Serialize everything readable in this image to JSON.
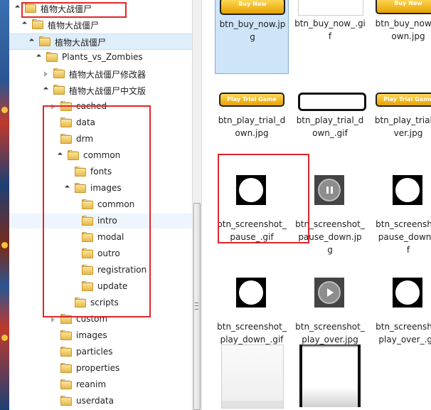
{
  "tree": [
    {
      "label": "植物大战僵尸",
      "depth": 0,
      "expanded": true,
      "state": ""
    },
    {
      "label": "植物大战僵尸",
      "depth": 1,
      "expanded": true,
      "state": ""
    },
    {
      "label": "植物大战僵尸",
      "depth": 2,
      "expanded": true,
      "state": "selected"
    },
    {
      "label": "Plants_vs_Zombies",
      "depth": 3,
      "expanded": true,
      "state": ""
    },
    {
      "label": "植物大战僵尸修改器",
      "depth": 4,
      "expanded": false,
      "state": ""
    },
    {
      "label": "植物大战僵尸中文版",
      "depth": 4,
      "expanded": true,
      "state": ""
    },
    {
      "label": "cached",
      "depth": 5,
      "expanded": false,
      "state": ""
    },
    {
      "label": "data",
      "depth": 5,
      "expanded": null,
      "state": ""
    },
    {
      "label": "drm",
      "depth": 5,
      "expanded": null,
      "state": ""
    },
    {
      "label": "common",
      "depth": 6,
      "expanded": true,
      "state": ""
    },
    {
      "label": "fonts",
      "depth": 7,
      "expanded": null,
      "state": ""
    },
    {
      "label": "images",
      "depth": 7,
      "expanded": true,
      "state": ""
    },
    {
      "label": "common",
      "depth": 8,
      "expanded": null,
      "state": ""
    },
    {
      "label": "intro",
      "depth": 8,
      "expanded": null,
      "state": "hover"
    },
    {
      "label": "modal",
      "depth": 8,
      "expanded": null,
      "state": ""
    },
    {
      "label": "outro",
      "depth": 8,
      "expanded": null,
      "state": ""
    },
    {
      "label": "registration",
      "depth": 8,
      "expanded": null,
      "state": ""
    },
    {
      "label": "update",
      "depth": 8,
      "expanded": null,
      "state": ""
    },
    {
      "label": "scripts",
      "depth": 7,
      "expanded": null,
      "state": ""
    },
    {
      "label": "custom",
      "depth": 5,
      "expanded": false,
      "state": ""
    },
    {
      "label": "images",
      "depth": 5,
      "expanded": null,
      "state": ""
    },
    {
      "label": "particles",
      "depth": 5,
      "expanded": null,
      "state": ""
    },
    {
      "label": "properties",
      "depth": 5,
      "expanded": null,
      "state": ""
    },
    {
      "label": "reanim",
      "depth": 5,
      "expanded": null,
      "state": ""
    },
    {
      "label": "userdata",
      "depth": 5,
      "expanded": null,
      "state": ""
    }
  ],
  "files": [
    {
      "name": "btn_buy_now.jpg",
      "lines": [
        "btn_buy_now.jp",
        "g"
      ],
      "thumb": "buy",
      "selected": true
    },
    {
      "name": "btn_buy_now_.gif",
      "lines": [
        "btn_buy_now_.gi",
        "f"
      ],
      "thumb": "blank-white",
      "selected": false
    },
    {
      "name": "btn_buy_now_down.jpg",
      "lines": [
        "btn_buy_now_d",
        "own.jpg"
      ],
      "thumb": "buy",
      "selected": false
    },
    {
      "name": "btn_play_trial_down.jpg",
      "lines": [
        "btn_play_trial_d",
        "own.jpg"
      ],
      "thumb": "trial",
      "selected": false
    },
    {
      "name": "btn_play_trial_down_.gif",
      "lines": [
        "btn_play_trial_d",
        "own_.gif"
      ],
      "thumb": "blank-white-bar",
      "selected": false
    },
    {
      "name": "btn_play_trial_over.jpg",
      "lines": [
        "btn_play_trial_o",
        "ver.jpg"
      ],
      "thumb": "trial",
      "selected": false
    },
    {
      "name": "btn_screenshot_pause_.gif",
      "lines": [
        "btn_screenshot_",
        "pause_.gif"
      ],
      "thumb": "black-circle",
      "selected": false
    },
    {
      "name": "btn_screenshot_pause_down.jpg",
      "lines": [
        "btn_screenshot_",
        "pause_down.jp",
        "g"
      ],
      "thumb": "pause",
      "selected": false
    },
    {
      "name": "btn_screenshot_pause_down_.gif",
      "lines": [
        "btn_screenshot",
        "pause_down_.",
        "f"
      ],
      "thumb": "black-circle",
      "selected": false
    },
    {
      "name": "btn_screenshot_play_down_.gif",
      "lines": [
        "btn_screenshot_",
        "play_down_.gif"
      ],
      "thumb": "black-circle",
      "selected": false
    },
    {
      "name": "btn_screenshot_play_over.jpg",
      "lines": [
        "btn_screenshot_",
        "play_over.jpg"
      ],
      "thumb": "play",
      "selected": false
    },
    {
      "name": "btn_screenshot_play_over_.gif",
      "lines": [
        "btn_screenshot",
        "play_over_.gif"
      ],
      "thumb": "black-circle",
      "selected": false
    },
    {
      "name": "",
      "lines": [],
      "thumb": "panel-white",
      "selected": false
    },
    {
      "name": "",
      "lines": [],
      "thumb": "panel-gradient",
      "selected": false
    }
  ],
  "thumb_text": {
    "buy": "Buy Now",
    "trial": "Play Trial Game"
  },
  "colors": {
    "annotation": "#e0262a",
    "selection": "#cde4f9",
    "folder": "#e6b94c"
  }
}
